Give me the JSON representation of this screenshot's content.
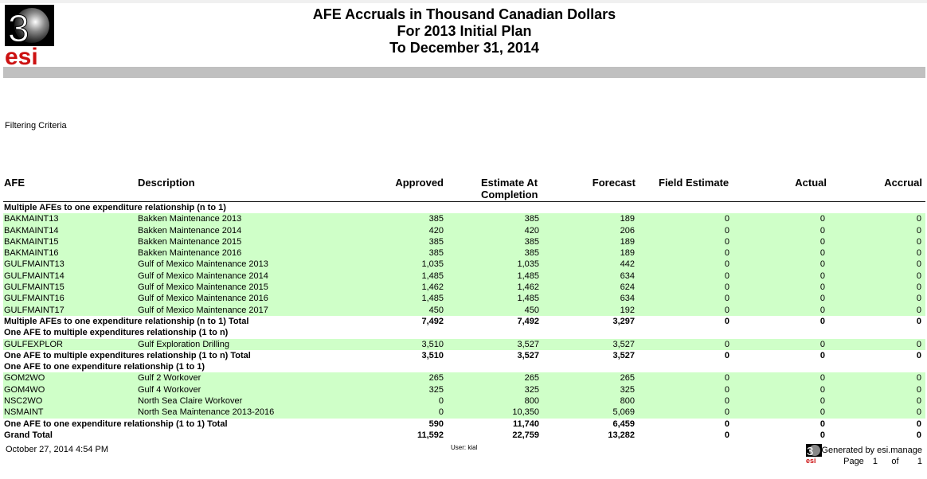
{
  "report": {
    "title_line1": "AFE Accruals in Thousand Canadian Dollars",
    "title_line2": "For 2013 Initial Plan",
    "title_line3": "To December 31, 2014",
    "filtering_label": "Filtering Criteria"
  },
  "logo": {
    "text_top": "3",
    "text_bottom": "esi"
  },
  "columns": {
    "afe": "AFE",
    "description": "Description",
    "approved": "Approved",
    "estimate_line1": "Estimate At",
    "estimate_line2": "Completion",
    "forecast": "Forecast",
    "field_estimate": "Field Estimate",
    "actual": "Actual",
    "accrual": "Accrual"
  },
  "rows": [
    {
      "kind": "sec",
      "afe": "Multiple AFEs to one expenditure relationship (n to 1)",
      "desc": "",
      "approved": "",
      "estimate": "",
      "forecast": "",
      "field": "",
      "actual": "",
      "accrual": ""
    },
    {
      "kind": "green",
      "afe": "BAKMAINT13",
      "desc": "Bakken Maintenance 2013",
      "approved": "385",
      "estimate": "385",
      "forecast": "189",
      "field": "0",
      "actual": "0",
      "accrual": "0"
    },
    {
      "kind": "green",
      "afe": "BAKMAINT14",
      "desc": "Bakken Maintenance 2014",
      "approved": "420",
      "estimate": "420",
      "forecast": "206",
      "field": "0",
      "actual": "0",
      "accrual": "0"
    },
    {
      "kind": "green",
      "afe": "BAKMAINT15",
      "desc": "Bakken Maintenance 2015",
      "approved": "385",
      "estimate": "385",
      "forecast": "189",
      "field": "0",
      "actual": "0",
      "accrual": "0"
    },
    {
      "kind": "green",
      "afe": "BAKMAINT16",
      "desc": "Bakken Maintenance 2016",
      "approved": "385",
      "estimate": "385",
      "forecast": "189",
      "field": "0",
      "actual": "0",
      "accrual": "0"
    },
    {
      "kind": "green",
      "afe": "GULFMAINT13",
      "desc": "Gulf of Mexico Maintenance 2013",
      "approved": "1,035",
      "estimate": "1,035",
      "forecast": "442",
      "field": "0",
      "actual": "0",
      "accrual": "0"
    },
    {
      "kind": "green",
      "afe": "GULFMAINT14",
      "desc": "Gulf of Mexico Maintenance 2014",
      "approved": "1,485",
      "estimate": "1,485",
      "forecast": "634",
      "field": "0",
      "actual": "0",
      "accrual": "0"
    },
    {
      "kind": "green",
      "afe": "GULFMAINT15",
      "desc": "Gulf of Mexico Maintenance 2015",
      "approved": "1,462",
      "estimate": "1,462",
      "forecast": "624",
      "field": "0",
      "actual": "0",
      "accrual": "0"
    },
    {
      "kind": "green",
      "afe": "GULFMAINT16",
      "desc": "Gulf of Mexico Maintenance 2016",
      "approved": "1,485",
      "estimate": "1,485",
      "forecast": "634",
      "field": "0",
      "actual": "0",
      "accrual": "0"
    },
    {
      "kind": "green",
      "afe": "GULFMAINT17",
      "desc": "Gulf of Mexico Maintenance 2017",
      "approved": "450",
      "estimate": "450",
      "forecast": "192",
      "field": "0",
      "actual": "0",
      "accrual": "0"
    },
    {
      "kind": "tot",
      "afe": "Multiple AFEs to one expenditure relationship (n to 1) Total",
      "desc": "",
      "approved": "7,492",
      "estimate": "7,492",
      "forecast": "3,297",
      "field": "0",
      "actual": "0",
      "accrual": "0"
    },
    {
      "kind": "sec",
      "afe": "One AFE to multiple expenditures relationship (1 to n)",
      "desc": "",
      "approved": "",
      "estimate": "",
      "forecast": "",
      "field": "",
      "actual": "",
      "accrual": ""
    },
    {
      "kind": "green",
      "afe": "GULFEXPLOR",
      "desc": "Gulf Exploration Drilling",
      "approved": "3,510",
      "estimate": "3,527",
      "forecast": "3,527",
      "field": "0",
      "actual": "0",
      "accrual": "0"
    },
    {
      "kind": "tot",
      "afe": "One AFE to multiple expenditures relationship (1 to n) Total",
      "desc": "",
      "approved": "3,510",
      "estimate": "3,527",
      "forecast": "3,527",
      "field": "0",
      "actual": "0",
      "accrual": "0"
    },
    {
      "kind": "sec",
      "afe": "One AFE to one expenditure relationship (1 to 1)",
      "desc": "",
      "approved": "",
      "estimate": "",
      "forecast": "",
      "field": "",
      "actual": "",
      "accrual": ""
    },
    {
      "kind": "green",
      "afe": "GOM2WO",
      "desc": "Gulf 2 Workover",
      "approved": "265",
      "estimate": "265",
      "forecast": "265",
      "field": "0",
      "actual": "0",
      "accrual": "0"
    },
    {
      "kind": "green",
      "afe": "GOM4WO",
      "desc": "Gulf 4 Workover",
      "approved": "325",
      "estimate": "325",
      "forecast": "325",
      "field": "0",
      "actual": "0",
      "accrual": "0"
    },
    {
      "kind": "green",
      "afe": "NSC2WO",
      "desc": "North Sea Claire Workover",
      "approved": "0",
      "estimate": "800",
      "forecast": "800",
      "field": "0",
      "actual": "0",
      "accrual": "0"
    },
    {
      "kind": "green",
      "afe": "NSMAINT",
      "desc": "North Sea Maintenance 2013-2016",
      "approved": "0",
      "estimate": "10,350",
      "forecast": "5,069",
      "field": "0",
      "actual": "0",
      "accrual": "0"
    },
    {
      "kind": "tot",
      "afe": "One AFE to one expenditure relationship (1 to 1) Total",
      "desc": "",
      "approved": "590",
      "estimate": "11,740",
      "forecast": "6,459",
      "field": "0",
      "actual": "0",
      "accrual": "0"
    },
    {
      "kind": "tot",
      "afe": "Grand Total",
      "desc": "",
      "approved": "11,592",
      "estimate": "22,759",
      "forecast": "13,282",
      "field": "0",
      "actual": "0",
      "accrual": "0"
    }
  ],
  "footer": {
    "date": "October 27, 2014 4:54 PM",
    "user": "User: kial",
    "generated": "Generated by esi.manage",
    "page_label": "Page",
    "page_num": "1",
    "of_label": "of",
    "page_total": "1"
  },
  "colors": {
    "row_green": "#cfffc8",
    "header_bar": "#c0c0c0",
    "logo_red": "#cc1111"
  }
}
